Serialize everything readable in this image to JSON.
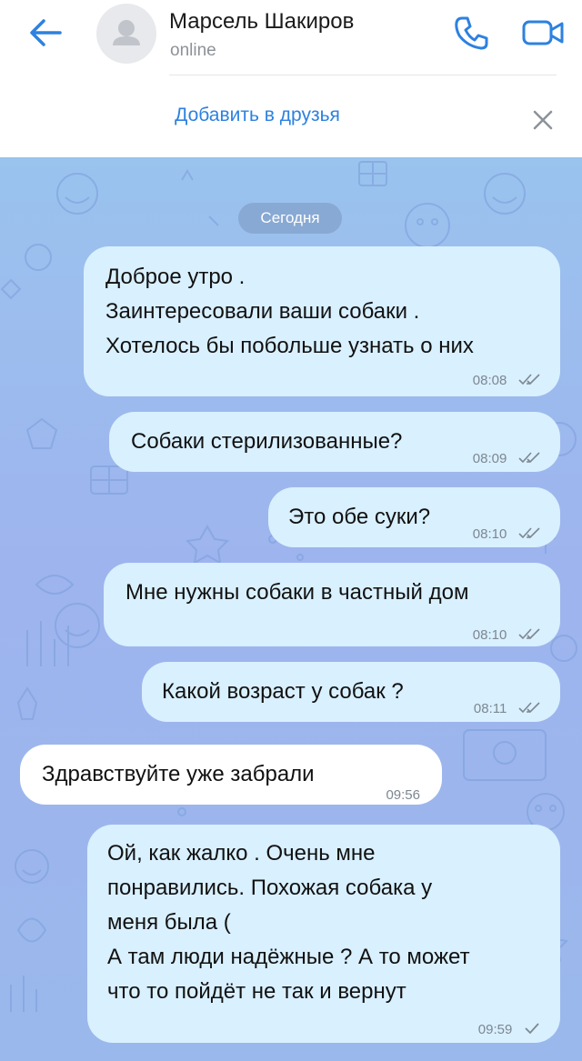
{
  "header": {
    "contact_name": "Марсель Шакиров",
    "status": "online"
  },
  "friend_bar": {
    "add_friend_label": "Добавить в друзья"
  },
  "chat": {
    "date_label": "Сегодня",
    "messages": [
      {
        "direction": "outgoing",
        "lines": [
          "Доброе утро .",
          "Заинтересовали ваши собаки .",
          "Хотелось бы побольше узнать о них"
        ],
        "time": "08:08",
        "status": "read"
      },
      {
        "direction": "outgoing",
        "lines": [
          "Собаки стерилизованные?"
        ],
        "time": "08:09",
        "status": "read"
      },
      {
        "direction": "outgoing",
        "lines": [
          "Это обе суки?"
        ],
        "time": "08:10",
        "status": "read"
      },
      {
        "direction": "outgoing",
        "lines": [
          "Мне нужны собаки в частный дом"
        ],
        "time": "08:10",
        "status": "read"
      },
      {
        "direction": "outgoing",
        "lines": [
          "Какой возраст у собак ?"
        ],
        "time": "08:11",
        "status": "read"
      },
      {
        "direction": "incoming",
        "lines": [
          "Здравствуйте уже забрали"
        ],
        "time": "09:56"
      },
      {
        "direction": "outgoing",
        "lines": [
          "Ой, как жалко . Очень мне",
          "понравились. Похожая собака у",
          "меня была (",
          "А там люди надёжные ? А то может",
          "что то пойдёт не так и вернут"
        ],
        "time": "09:59",
        "status": "sent"
      }
    ]
  },
  "colors": {
    "accent": "#2d81e0",
    "outgoing_bubble": "#d9f0ff",
    "incoming_bubble": "#ffffff",
    "chat_background": "#9ab8ec"
  },
  "icons": [
    "back-arrow-icon",
    "avatar-placeholder-icon",
    "phone-icon",
    "video-camera-icon",
    "close-icon",
    "double-check-icon",
    "single-check-icon"
  ]
}
